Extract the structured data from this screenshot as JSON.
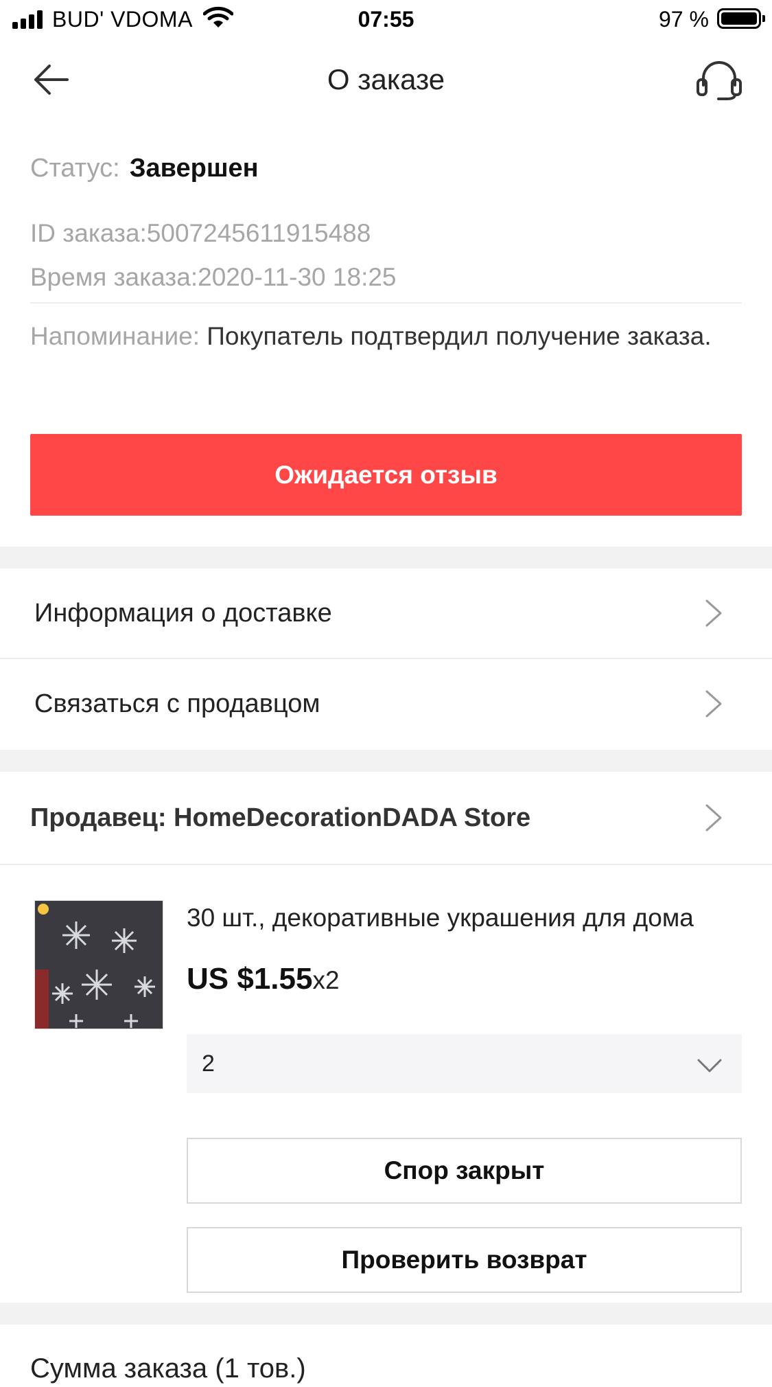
{
  "status_bar": {
    "carrier": "BUD' VDOMA",
    "time": "07:55",
    "battery_percent": "97 %"
  },
  "nav": {
    "title": "О заказе",
    "back_icon": "arrow-left-icon",
    "support_icon": "headset-icon"
  },
  "order": {
    "status_label": "Статус:",
    "status_value": "Завершен",
    "id_line": "ID заказа:5007245611915488",
    "time_line": "Время заказа:2020-11-30 18:25",
    "reminder_label": "Напоминание:",
    "reminder_text": "Покупатель подтвердил получение заказа."
  },
  "review_button": "Ожидается отзыв",
  "menu": [
    {
      "label": "Информация о доставке"
    },
    {
      "label": "Связаться с продавцом"
    }
  ],
  "seller": {
    "label": "Продавец: HomeDecorationDADA Store"
  },
  "product": {
    "title": "30 шт., декоративные украшения для дома",
    "price": "US $1.55",
    "quantity": "x2",
    "sku_value": "2",
    "buttons": {
      "dispute": "Спор закрыт",
      "return": "Проверить возврат"
    }
  },
  "summary": {
    "title": "Сумма заказа (1 тов.)"
  },
  "colors": {
    "accent": "#ff4747",
    "divider_bg": "#f2f2f2",
    "gray_text": "#a6a6a6"
  }
}
